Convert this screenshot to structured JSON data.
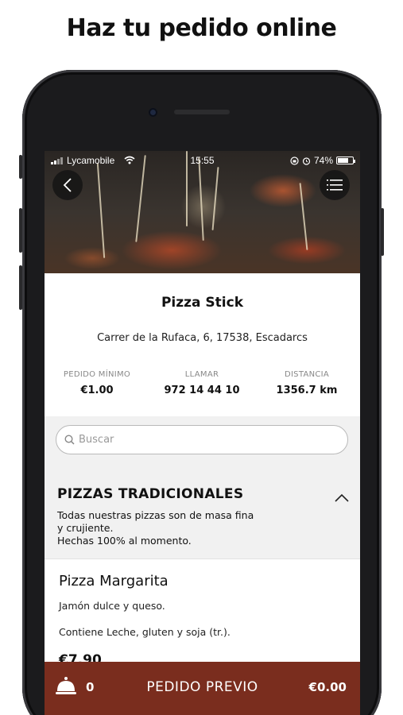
{
  "headline": "Haz tu pedido online",
  "status_bar": {
    "carrier": "Lycamobile",
    "time": "15:55",
    "battery": "74%",
    "battery_level": 0.74,
    "icons": [
      "signal-icon",
      "wifi-icon",
      "lock-rotation-icon",
      "alarm-icon",
      "battery-icon"
    ]
  },
  "header": {
    "back_icon": "chevron-left-icon",
    "menu_icon": "hamburger-menu-icon"
  },
  "restaurant": {
    "name": "Pizza Stick",
    "address": "Carrer de la Rufaca, 6, 17538, Escadarcs",
    "stats": [
      {
        "label": "PEDIDO MÍNIMO",
        "value": "€1.00"
      },
      {
        "label": "LLAMAR",
        "value": "972 14 44 10"
      },
      {
        "label": "DISTANCIA",
        "value": "1356.7 km"
      }
    ]
  },
  "search": {
    "placeholder": "Buscar",
    "icon": "search-icon"
  },
  "category": {
    "title": "PIZZAS TRADICIONALES",
    "description_lines": [
      "Todas nuestras pizzas son de masa fina",
      "y crujiente.",
      "Hechas 100% al momento."
    ],
    "toggle_icon": "chevron-up-icon"
  },
  "products": [
    {
      "name": "Pizza Margarita",
      "description": "Jamón dulce y queso.",
      "allergens": "Contiene Leche, gluten y soja (tr.).",
      "price": "€7.90"
    }
  ],
  "order_bar": {
    "icon": "service-bell-icon",
    "count": "0",
    "label": "PEDIDO PREVIO",
    "total": "€0.00",
    "color": "#7a2d1e"
  },
  "colors": {
    "accent": "#7a2d1e",
    "background": "#f1f1f1"
  }
}
